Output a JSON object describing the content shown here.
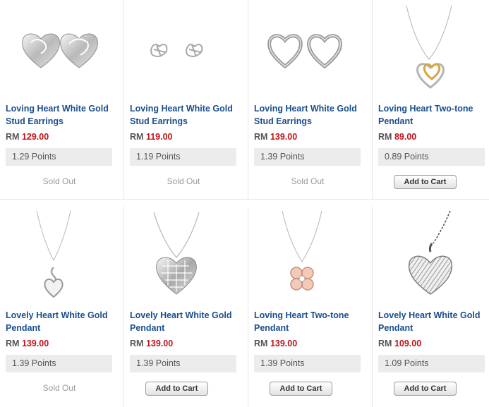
{
  "products": [
    {
      "name": "Loving Heart White Gold Stud Earrings",
      "currency": "RM",
      "price": "129.00",
      "points": "1.29 Points",
      "status": "Sold Out",
      "image": "heart-stud-earrings-swirl"
    },
    {
      "name": "Loving Heart White Gold Stud Earrings",
      "currency": "RM",
      "price": "119.00",
      "points": "1.19 Points",
      "status": "Sold Out",
      "image": "heart-stud-earrings-open"
    },
    {
      "name": "Loving Heart White Gold Stud Earrings",
      "currency": "RM",
      "price": "139.00",
      "points": "1.39 Points",
      "status": "Sold Out",
      "image": "heart-stud-earrings-outline"
    },
    {
      "name": "Loving Heart Two-tone Pendant",
      "currency": "RM",
      "price": "89.00",
      "points": "0.89 Points",
      "status": "Add to Cart",
      "image": "two-tone-heart-pendant"
    },
    {
      "name": "Lovely Heart White Gold Pendant",
      "currency": "RM",
      "price": "139.00",
      "points": "1.39 Points",
      "status": "Sold Out",
      "image": "small-heart-pendant"
    },
    {
      "name": "Lovely Heart White Gold Pendant",
      "currency": "RM",
      "price": "139.00",
      "points": "1.39 Points",
      "status": "Add to Cart",
      "image": "faceted-heart-pendant"
    },
    {
      "name": "Loving Heart Two-tone Pendant",
      "currency": "RM",
      "price": "139.00",
      "points": "1.39 Points",
      "status": "Add to Cart",
      "image": "clover-pendant"
    },
    {
      "name": "Lovely Heart White Gold Pendant",
      "currency": "RM",
      "price": "109.00",
      "points": "1.09 Points",
      "status": "Add to Cart",
      "image": "textured-heart-pendant"
    }
  ]
}
